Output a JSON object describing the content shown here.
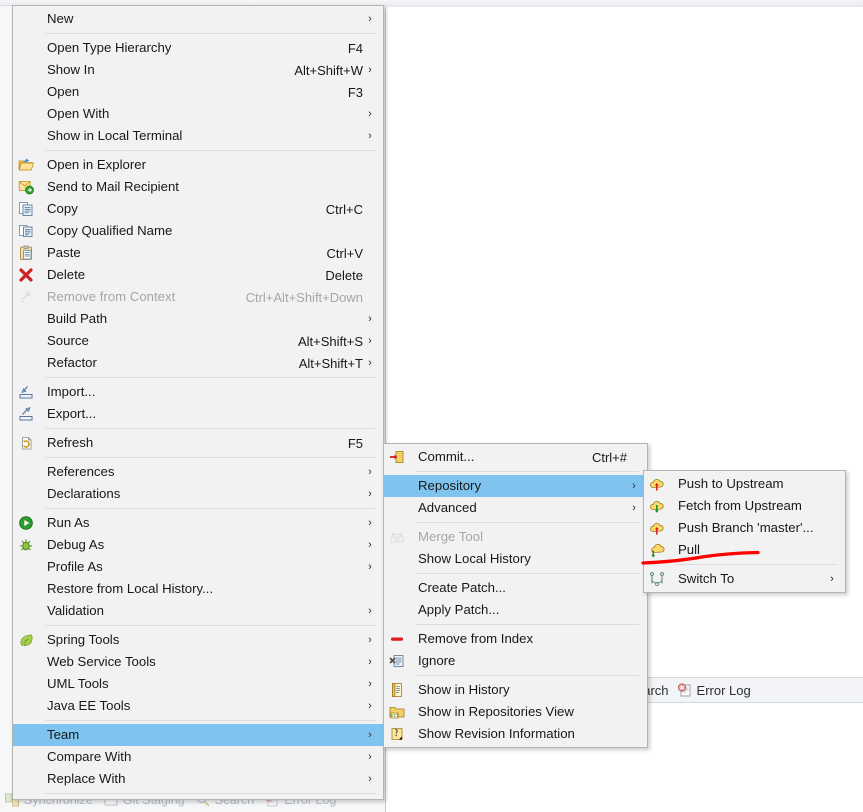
{
  "app": {
    "background": {
      "view_tabs": [
        {
          "label": "earch",
          "icon": "search-icon"
        },
        {
          "label": "Error Log",
          "icon": "error-log-icon"
        }
      ],
      "status_tabs": [
        {
          "label": "Synchronize",
          "icon": "synchronize-icon"
        },
        {
          "label": "Git Staging",
          "icon": "git-staging-icon"
        },
        {
          "label": "Search",
          "icon": "search-icon"
        },
        {
          "label": "Error Log",
          "icon": "error-log-icon"
        }
      ]
    }
  },
  "colors": {
    "menu_bg": "#f2f2f2",
    "menu_border": "#b4b4b4",
    "highlight": "#7fc4ee",
    "separator": "#dcdcdc",
    "disabled_text": "#a6a6a6",
    "annotation_red": "#fe0000"
  },
  "context_menu": {
    "name": "project-context-menu",
    "items": [
      {
        "label": "New",
        "accel": "",
        "submenu": true,
        "icon": "",
        "disabled": false
      },
      {
        "separator": true
      },
      {
        "label": "Open Type Hierarchy",
        "accel": "F4",
        "submenu": false,
        "icon": "",
        "disabled": false
      },
      {
        "label": "Show In",
        "accel": "Alt+Shift+W",
        "submenu": true,
        "icon": "",
        "disabled": false
      },
      {
        "label": "Open",
        "accel": "F3",
        "submenu": false,
        "icon": "",
        "disabled": false
      },
      {
        "label": "Open With",
        "accel": "",
        "submenu": true,
        "icon": "",
        "disabled": false
      },
      {
        "label": "Show in Local Terminal",
        "accel": "",
        "submenu": true,
        "icon": "",
        "disabled": false
      },
      {
        "separator": true
      },
      {
        "label": "Open in Explorer",
        "accel": "",
        "submenu": false,
        "icon": "open-folder-icon",
        "disabled": false
      },
      {
        "label": "Send to Mail Recipient",
        "accel": "",
        "submenu": false,
        "icon": "mail-send-icon",
        "disabled": false
      },
      {
        "label": "Copy",
        "accel": "Ctrl+C",
        "submenu": false,
        "icon": "copy-icon",
        "disabled": false
      },
      {
        "label": "Copy Qualified Name",
        "accel": "",
        "submenu": false,
        "icon": "copy-qualified-icon",
        "disabled": false
      },
      {
        "label": "Paste",
        "accel": "Ctrl+V",
        "submenu": false,
        "icon": "paste-icon",
        "disabled": false
      },
      {
        "label": "Delete",
        "accel": "Delete",
        "submenu": false,
        "icon": "delete-x-icon",
        "disabled": false
      },
      {
        "label": "Remove from Context",
        "accel": "Ctrl+Alt+Shift+Down",
        "submenu": false,
        "icon": "remove-context-icon",
        "disabled": true
      },
      {
        "label": "Build Path",
        "accel": "",
        "submenu": true,
        "icon": "",
        "disabled": false
      },
      {
        "label": "Source",
        "accel": "Alt+Shift+S",
        "submenu": true,
        "icon": "",
        "disabled": false
      },
      {
        "label": "Refactor",
        "accel": "Alt+Shift+T",
        "submenu": true,
        "icon": "",
        "disabled": false
      },
      {
        "separator": true
      },
      {
        "label": "Import...",
        "accel": "",
        "submenu": false,
        "icon": "import-icon",
        "disabled": false
      },
      {
        "label": "Export...",
        "accel": "",
        "submenu": false,
        "icon": "export-icon",
        "disabled": false
      },
      {
        "separator": true
      },
      {
        "label": "Refresh",
        "accel": "F5",
        "submenu": false,
        "icon": "refresh-icon",
        "disabled": false
      },
      {
        "separator": true
      },
      {
        "label": "References",
        "accel": "",
        "submenu": true,
        "icon": "",
        "disabled": false
      },
      {
        "label": "Declarations",
        "accel": "",
        "submenu": true,
        "icon": "",
        "disabled": false
      },
      {
        "separator": true
      },
      {
        "label": "Run As",
        "accel": "",
        "submenu": true,
        "icon": "run-icon",
        "disabled": false
      },
      {
        "label": "Debug As",
        "accel": "",
        "submenu": true,
        "icon": "debug-icon",
        "disabled": false
      },
      {
        "label": "Profile As",
        "accel": "",
        "submenu": true,
        "icon": "",
        "disabled": false
      },
      {
        "label": "Restore from Local History...",
        "accel": "",
        "submenu": false,
        "icon": "",
        "disabled": false
      },
      {
        "label": "Validation",
        "accel": "",
        "submenu": true,
        "icon": "",
        "disabled": false
      },
      {
        "separator": true
      },
      {
        "label": "Spring Tools",
        "accel": "",
        "submenu": true,
        "icon": "spring-leaf-icon",
        "disabled": false
      },
      {
        "label": "Web Service Tools",
        "accel": "",
        "submenu": true,
        "icon": "",
        "disabled": false
      },
      {
        "label": "UML Tools",
        "accel": "",
        "submenu": true,
        "icon": "",
        "disabled": false
      },
      {
        "label": "Java EE Tools",
        "accel": "",
        "submenu": true,
        "icon": "",
        "disabled": false
      },
      {
        "separator": true
      },
      {
        "label": "Team",
        "accel": "",
        "submenu": true,
        "icon": "",
        "disabled": false,
        "selected": true
      },
      {
        "label": "Compare With",
        "accel": "",
        "submenu": true,
        "icon": "",
        "disabled": false
      },
      {
        "label": "Replace With",
        "accel": "",
        "submenu": true,
        "icon": "",
        "disabled": false
      },
      {
        "separator": true
      }
    ]
  },
  "team_menu": {
    "name": "team-submenu",
    "items": [
      {
        "label": "Commit...",
        "accel": "Ctrl+#",
        "submenu": false,
        "icon": "commit-icon",
        "disabled": false
      },
      {
        "separator": true
      },
      {
        "label": "Repository",
        "accel": "",
        "submenu": true,
        "icon": "",
        "disabled": false,
        "selected": true
      },
      {
        "label": "Advanced",
        "accel": "",
        "submenu": true,
        "icon": "",
        "disabled": false
      },
      {
        "separator": true
      },
      {
        "label": "Merge Tool",
        "accel": "",
        "submenu": false,
        "icon": "merge-tool-icon",
        "disabled": true
      },
      {
        "label": "Show Local History",
        "accel": "",
        "submenu": false,
        "icon": "",
        "disabled": false
      },
      {
        "separator": true
      },
      {
        "label": "Create Patch...",
        "accel": "",
        "submenu": false,
        "icon": "",
        "disabled": false
      },
      {
        "label": "Apply Patch...",
        "accel": "",
        "submenu": false,
        "icon": "",
        "disabled": false
      },
      {
        "separator": true
      },
      {
        "label": "Remove from Index",
        "accel": "",
        "submenu": false,
        "icon": "remove-index-icon",
        "disabled": false
      },
      {
        "label": "Ignore",
        "accel": "",
        "submenu": false,
        "icon": "ignore-icon",
        "disabled": false
      },
      {
        "separator": true
      },
      {
        "label": "Show in History",
        "accel": "",
        "submenu": false,
        "icon": "history-icon",
        "disabled": false
      },
      {
        "label": "Show in Repositories View",
        "accel": "",
        "submenu": false,
        "icon": "git-repo-icon",
        "disabled": false
      },
      {
        "label": "Show Revision Information",
        "accel": "",
        "submenu": false,
        "icon": "revision-info-icon",
        "disabled": false
      }
    ]
  },
  "repository_menu": {
    "name": "repository-submenu",
    "items": [
      {
        "label": "Push to Upstream",
        "accel": "",
        "submenu": false,
        "icon": "push-cloud-icon",
        "disabled": false
      },
      {
        "label": "Fetch from Upstream",
        "accel": "",
        "submenu": false,
        "icon": "fetch-cloud-icon",
        "disabled": false
      },
      {
        "label": "Push Branch 'master'...",
        "accel": "",
        "submenu": false,
        "icon": "push-cloud-icon",
        "disabled": false
      },
      {
        "label": "Pull",
        "accel": "",
        "submenu": false,
        "icon": "pull-cloud-icon",
        "disabled": false,
        "annotated": true
      },
      {
        "separator": true
      },
      {
        "label": "Switch To",
        "accel": "",
        "submenu": true,
        "icon": "switch-to-icon",
        "disabled": false
      }
    ]
  },
  "annotation": {
    "name": "red-underline-annotation",
    "target": "Pull",
    "color": "#fe0000"
  }
}
